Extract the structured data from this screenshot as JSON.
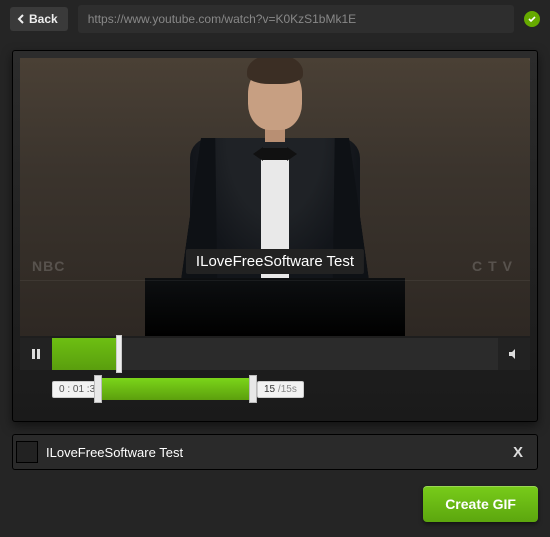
{
  "topbar": {
    "back_label": "Back",
    "url": "https://www.youtube.com/watch?v=K0KzS1bMk1E",
    "status": "ok"
  },
  "video": {
    "caption_overlay": "ILoveFreeSoftware Test",
    "watermark_left": "NBC",
    "watermark_right": "CTV"
  },
  "player": {
    "state": "playing",
    "progress_percent": 15
  },
  "trim": {
    "start_time": "0 : 01 :39",
    "selected_seconds": "15",
    "max_seconds": "15"
  },
  "caption_input": {
    "value": "ILoveFreeSoftware Test",
    "clear_label": "X"
  },
  "actions": {
    "create_label": "Create GIF"
  }
}
